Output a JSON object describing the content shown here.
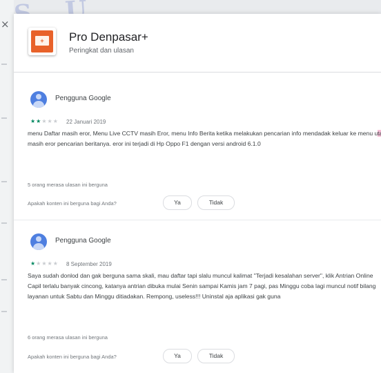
{
  "dialog": {
    "app_name": "Pro Denpasar+",
    "subtitle": "Peringkat dan ulasan",
    "close_glyph": "×"
  },
  "reviews": [
    {
      "author": "Pengguna Google",
      "rating": 2,
      "max_rating": 5,
      "date": "22 Januari 2019",
      "text_before": "menu Daftar masih eror, Menu Live CCTV masih Eror, menu Info Berita ketika melakukan pencarian info mendadak keluar ke menu u",
      "text_highlight": "tama",
      "text_after": " masih eror pencarian beritanya. eror ini terjadi di Hp Oppo F1 dengan versi android 6.1.0",
      "helpful_count_text": "5 orang merasa ulasan ini berguna",
      "helpful_question": "Apakah konten ini berguna bagi Anda?",
      "yes_label": "Ya",
      "no_label": "Tidak"
    },
    {
      "author": "Pengguna Google",
      "rating": 1,
      "max_rating": 5,
      "date": "8 September 2019",
      "text_before": "Saya sudah donlod dan gak berguna sama skali, mau daftar tapi slalu muncul kalimat \"Terjadi kesalahan server\", klik Antrian Online Capil terlalu banyak cincong, katanya antrian dibuka mulai Senin sampai Kamis jam 7 pagi, pas Minggu coba lagi muncul notif bilang layanan untuk Sabtu dan Minggu ditiadakan. Rempong, useless!!! Uninstal aja aplikasi gak guna",
      "text_highlight": "",
      "text_after": "",
      "helpful_count_text": "6 orang merasa ulasan ini berguna",
      "helpful_question": "Apakah konten ini berguna bagi Anda?",
      "yes_label": "Ya",
      "no_label": "Tidak"
    }
  ],
  "icons": {
    "close": "close-icon",
    "app": "app-logo-icon",
    "avatar": "user-avatar-icon",
    "star": "star-icon"
  },
  "colors": {
    "star_on": "#01875f",
    "star_off": "#c9ccd0",
    "avatar": "#4e7fe0",
    "app_icon": "#e8622a"
  }
}
